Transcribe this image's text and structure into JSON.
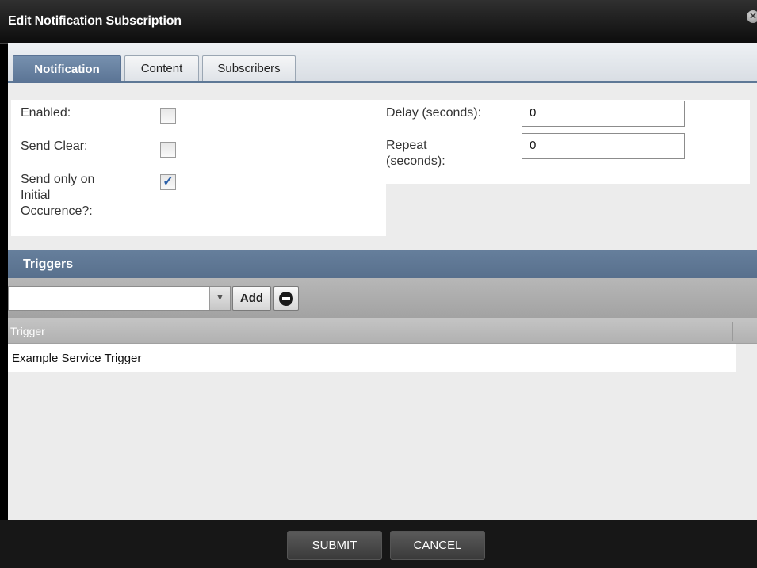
{
  "dialog": {
    "title": "Edit Notification Subscription",
    "close_icon": "close-icon"
  },
  "tabs": [
    {
      "label": "Notification",
      "active": true
    },
    {
      "label": "Content",
      "active": false
    },
    {
      "label": "Subscribers",
      "active": false
    }
  ],
  "form": {
    "enabled": {
      "label": "Enabled:",
      "checked": false
    },
    "send_clear": {
      "label": "Send Clear:",
      "checked": false
    },
    "send_initial": {
      "label_lines": [
        "Send only on",
        "Initial",
        "Occurence?:"
      ],
      "checked": true,
      "check_glyph": "✓"
    },
    "delay": {
      "label": "Delay (seconds):",
      "value": "0"
    },
    "repeat": {
      "label_lines": [
        "Repeat",
        "(seconds):"
      ],
      "value": "0"
    }
  },
  "triggers": {
    "title": "Triggers",
    "combo_value": "",
    "combo_arrow_icon": "chevron-down-icon",
    "add_label": "Add",
    "remove_icon": "remove-icon",
    "column_header": "Trigger",
    "rows": [
      "Example Service Trigger"
    ]
  },
  "footer": {
    "submit_label": "SUBMIT",
    "cancel_label": "CANCEL"
  },
  "colors": {
    "accent": "#5e7896",
    "titlebar": "#0d0d0d",
    "footer": "#171717"
  }
}
